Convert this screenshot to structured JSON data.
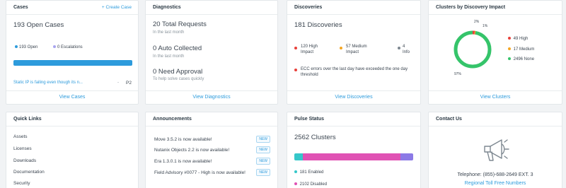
{
  "cases": {
    "title": "Cases",
    "create_label": "+ Create Case",
    "open_count_label": "193 Open Cases",
    "open_stat": "193 Open",
    "escalations_stat": "0 Escalations",
    "case_text": "Static IP is failing even though its n...",
    "case_dash": "-",
    "case_priority": "P2",
    "footer": "View Cases",
    "progress_fraction": 1.0,
    "colors": {
      "open": "#2d9bdc",
      "escalations": "#a9a5f0"
    }
  },
  "diagnostics": {
    "title": "Diagnostics",
    "items": [
      {
        "value": "20 Total Requests",
        "sub": "In the last month"
      },
      {
        "value": "0 Auto Collected",
        "sub": "In the last month"
      },
      {
        "value": "0 Need Approval",
        "sub": "To help solve cases quickly"
      }
    ],
    "footer": "View Diagnostics"
  },
  "discoveries": {
    "title": "Discoveries",
    "count_label": "181 Discoveries",
    "high": "120 High Impact",
    "medium": "57 Medium Impact",
    "info": "4 Info",
    "alert_text": "ECC errors over the last day have exceeded the one day threshold",
    "footer": "View Discoveries",
    "colors": {
      "high": "#e8403a",
      "medium": "#f5a623",
      "info": "#7d8790"
    }
  },
  "clusters_impact": {
    "title": "Clusters by Discovery Impact",
    "legend": [
      {
        "label": "49 High",
        "color": "#e8403a"
      },
      {
        "label": "17 Medium",
        "color": "#f5a623"
      },
      {
        "label": "2496 None",
        "color": "#35c46a"
      }
    ],
    "pct_high": "2%",
    "pct_medium": "1%",
    "pct_none": "97%",
    "footer": "View Clusters",
    "chart_data": {
      "type": "pie",
      "slices": [
        {
          "label": "High",
          "value": 49,
          "color": "#e8403a"
        },
        {
          "label": "Medium",
          "value": 17,
          "color": "#f5a623"
        },
        {
          "label": "None",
          "value": 2496,
          "color": "#35c46a"
        }
      ]
    }
  },
  "quick_links": {
    "title": "Quick Links",
    "items": [
      "Assets",
      "Licenses",
      "Downloads",
      "Documentation",
      "Security"
    ]
  },
  "announcements": {
    "title": "Announcements",
    "badge": "NEW",
    "items": [
      {
        "text": "Move 3.5.2 is now available!"
      },
      {
        "text": "Nutanix Objects 2.2 is now available!"
      },
      {
        "text": "Era 1.3.0.1 is now available!"
      },
      {
        "text": "Field Advisory #0077 - High is now available!"
      }
    ]
  },
  "pulse": {
    "title": "Pulse Status",
    "count_label": "2562 Clusters",
    "enabled": "181 Enabled",
    "disabled": "2102 Disabled",
    "bar_segments": [
      {
        "name": "enabled",
        "fraction": 0.07,
        "color": "#35c7c9"
      },
      {
        "name": "disabled",
        "fraction": 0.82,
        "color": "#e052b4"
      },
      {
        "name": "other",
        "fraction": 0.11,
        "color": "#8c7ae6"
      }
    ]
  },
  "contact": {
    "title": "Contact Us",
    "telephone": "Telephone: (855)-688-2649 EXT. 3",
    "regional_link": "Regional Toll Free Numbers"
  }
}
